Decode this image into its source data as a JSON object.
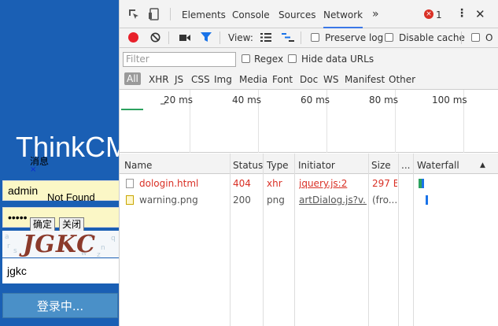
{
  "page": {
    "brand": "ThinkCM",
    "dialog_title": "消息",
    "dialog_close": "×",
    "username": "admin",
    "password": "•••••",
    "not_found": "Not Found",
    "ok_label": "确定",
    "close_label": "关闭",
    "captcha": "JGKC",
    "captcha_value": "jgkc",
    "login_label": "登录中..."
  },
  "devtools": {
    "tabs": [
      "Elements",
      "Console",
      "Sources",
      "Network"
    ],
    "more_tabs": "»",
    "error_count": "1",
    "toolbar": {
      "view_label": "View:",
      "preserve_log": "Preserve log",
      "disable_cache": "Disable cache"
    },
    "filter": {
      "placeholder": "Filter",
      "regex": "Regex",
      "hide_data_urls": "Hide data URLs"
    },
    "types": [
      "All",
      "XHR",
      "JS",
      "CSS",
      "Img",
      "Media",
      "Font",
      "Doc",
      "WS",
      "Manifest",
      "Other"
    ],
    "timeline_ticks": [
      "20 ms",
      "40 ms",
      "60 ms",
      "80 ms",
      "100 ms"
    ],
    "columns": [
      "Name",
      "Status",
      "Type",
      "Initiator",
      "Size",
      "...",
      "Waterfall"
    ],
    "rows": [
      {
        "name": "dologin.html",
        "status": "404",
        "type": "xhr",
        "initiator": "jquery.js:2",
        "size": "297 B"
      },
      {
        "name": "warning.png",
        "status": "200",
        "type": "png",
        "initiator": "artDialog.js?v...",
        "size": "(fro..."
      }
    ],
    "colors": {
      "accent": "#3b78e7",
      "error": "#d93025",
      "record": "#e8202a",
      "filter": "#1a73e8"
    }
  }
}
